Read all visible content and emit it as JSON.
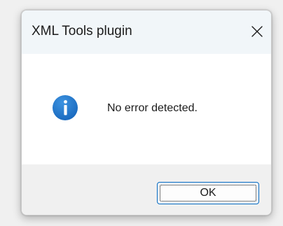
{
  "dialog": {
    "title": "XML Tools plugin",
    "close_icon": "close-icon",
    "message_icon": "info-icon",
    "message": "No error detected.",
    "ok_label": "OK"
  },
  "colors": {
    "info_icon_bg": "#1f73c9",
    "accent_border": "#0067c0",
    "titlebar_bg": "#f1f6f9",
    "footer_bg": "#f0f0f0"
  }
}
